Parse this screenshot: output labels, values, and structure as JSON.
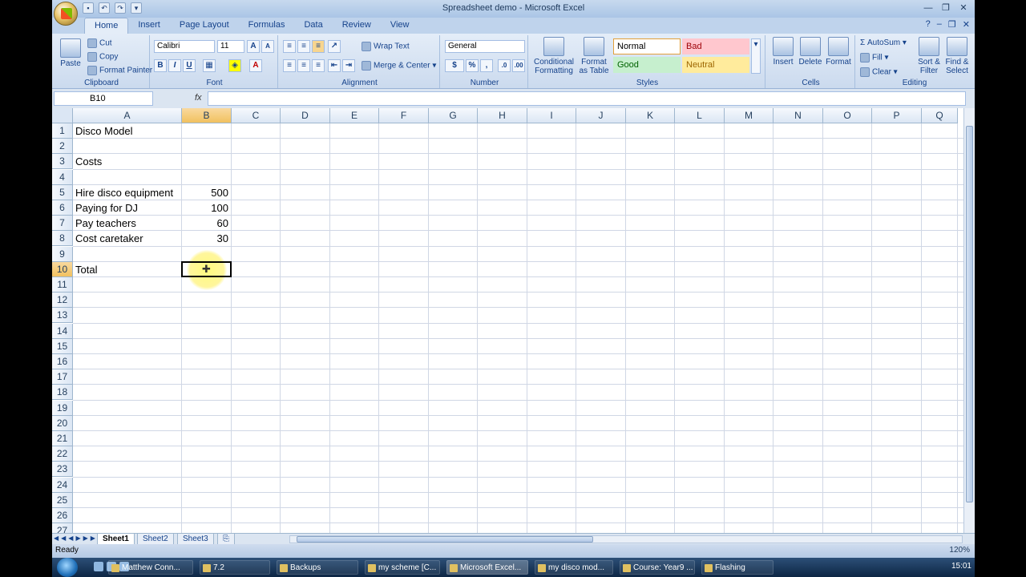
{
  "window": {
    "title": "Spreadsheet demo - Microsoft Excel",
    "qat_icons": [
      "save-icon",
      "undo-icon",
      "redo-icon",
      "customize-icon"
    ]
  },
  "tabs": [
    "Home",
    "Insert",
    "Page Layout",
    "Formulas",
    "Data",
    "Review",
    "View"
  ],
  "active_tab": "Home",
  "ribbon": {
    "clipboard": {
      "label": "Clipboard",
      "paste": "Paste",
      "cut": "Cut",
      "copy": "Copy",
      "format_painter": "Format Painter"
    },
    "font": {
      "label": "Font",
      "name": "Calibri",
      "size": "11",
      "bold": "B",
      "italic": "I",
      "underline": "U"
    },
    "alignment": {
      "label": "Alignment",
      "wrap": "Wrap Text",
      "merge": "Merge & Center"
    },
    "number": {
      "label": "Number",
      "format": "General",
      "percent": "%",
      "comma": ","
    },
    "styles": {
      "label": "Styles",
      "conditional": "Conditional Formatting",
      "format_table": "Format as Table",
      "normal": "Normal",
      "bad": "Bad",
      "good": "Good",
      "neutral": "Neutral",
      "colors": {
        "bad_bg": "#ffc7ce",
        "bad_fg": "#9c0006",
        "good_bg": "#c6efce",
        "good_fg": "#006100",
        "neutral_bg": "#ffeb9c",
        "neutral_fg": "#9c6500"
      }
    },
    "cells": {
      "label": "Cells",
      "insert": "Insert",
      "delete": "Delete",
      "format": "Format"
    },
    "editing": {
      "label": "Editing",
      "autosum": "AutoSum",
      "fill": "Fill",
      "clear": "Clear",
      "sort": "Sort & Filter",
      "find": "Find & Select"
    }
  },
  "formula_bar": {
    "name_box": "B10",
    "fx": "fx",
    "value": ""
  },
  "grid": {
    "columns": [
      "A",
      "B",
      "C",
      "D",
      "E",
      "F",
      "G",
      "H",
      "I",
      "J",
      "K",
      "L",
      "M",
      "N",
      "O",
      "P",
      "Q"
    ],
    "rows": [
      "1",
      "2",
      "3",
      "4",
      "5",
      "6",
      "7",
      "8",
      "9",
      "10",
      "11",
      "12",
      "13",
      "14",
      "15",
      "16",
      "17",
      "18",
      "19",
      "20",
      "21",
      "22",
      "23",
      "24",
      "25",
      "26",
      "27"
    ],
    "selected_column": "B",
    "selected_row": "10",
    "cells": {
      "A1": "Disco Model",
      "A3": "Costs",
      "A5": "Hire disco equipment",
      "B5": "500",
      "A6": "Paying for DJ",
      "B6": "100",
      "A7": "Pay teachers",
      "B7": "60",
      "A8": "Cost caretaker",
      "B8": "30",
      "A10": "Total"
    }
  },
  "sheets": [
    "Sheet1",
    "Sheet2",
    "Sheet3"
  ],
  "active_sheet": "Sheet1",
  "status": {
    "text": "Ready",
    "zoom": "120%"
  },
  "taskbar": {
    "items": [
      "Matthew Conn...",
      "7.2",
      "Backups",
      "my scheme [C...",
      "Microsoft Excel...",
      "my disco mod...",
      "Course: Year9 ...",
      "Flashing"
    ],
    "active": "Microsoft Excel...",
    "clock": "15:01"
  }
}
